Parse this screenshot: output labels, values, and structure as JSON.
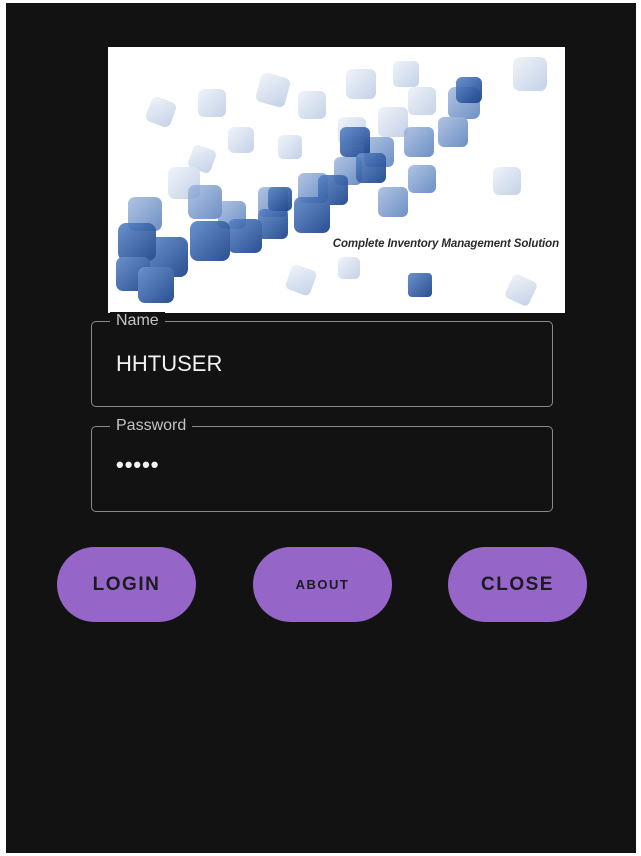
{
  "banner": {
    "tagline": "Complete Inventory Management Solution"
  },
  "form": {
    "name": {
      "label": "Name",
      "value": "HHTUSER"
    },
    "password": {
      "label": "Password",
      "value": "•••••"
    }
  },
  "buttons": {
    "login": "LOGIN",
    "about": "ABOUT",
    "close": "CLOSE"
  },
  "colors": {
    "background": "#121212",
    "button": "#9565c8",
    "button_text": "#1b1b22",
    "field_border": "#8a8a8a",
    "banner_cubes": "#2f5fa8"
  }
}
